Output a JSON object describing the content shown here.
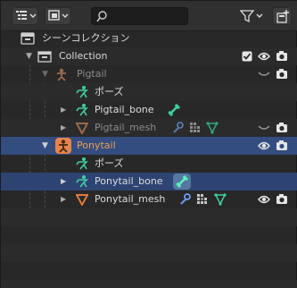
{
  "scene_collection": {
    "label": "シーンコレクション",
    "icon": "scene-collection-icon"
  },
  "collection": {
    "label": "Collection",
    "icon": "collection-icon"
  },
  "pigtail": {
    "label": "Pigtail",
    "pose_label": "ポーズ",
    "bone_label": "Pigtail_bone",
    "mesh_label": "Pigtail_mesh"
  },
  "ponytail": {
    "label": "Ponytail",
    "pose_label": "ポーズ",
    "bone_label": "Ponytail_bone",
    "mesh_label": "Ponytail_mesh"
  },
  "colors": {
    "header_bg": "#303030",
    "row_selected": "#334d80",
    "armature_orange": "#e8844a",
    "bone_green": "#3fd0a0",
    "mesh_orange": "#e07a3c",
    "modifier_blue": "#6a9ef0",
    "text_dim": "#8c8c8c"
  }
}
